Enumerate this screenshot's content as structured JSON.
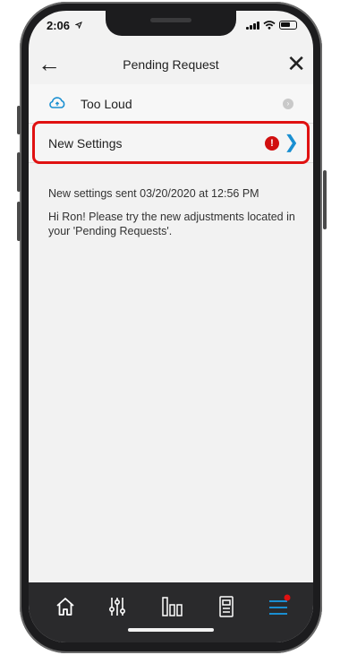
{
  "status_bar": {
    "time": "2:06"
  },
  "nav": {
    "title": "Pending Request",
    "back_icon": "back-arrow-icon",
    "close_icon": "close-icon"
  },
  "rows": {
    "too_loud": {
      "label": "Too Loud",
      "icon": "cloud-icon"
    },
    "new_settings": {
      "label": "New Settings",
      "alert_icon": "alert-icon",
      "chevron_icon": "chevron-right-icon"
    }
  },
  "info": {
    "sent": "New settings sent 03/20/2020 at 12:56 PM",
    "message": "Hi Ron! Please try the new adjustments located in your 'Pending Requests'."
  },
  "tab_bar": {
    "items": [
      "home-icon",
      "adjust-sliders-icon",
      "bars-icon",
      "device-icon",
      "menu-icon"
    ]
  },
  "colors": {
    "accent": "#1a8fd1",
    "alert": "#d10f0f",
    "highlight": "#e01111",
    "tab_bar": "#2a2a2c"
  }
}
